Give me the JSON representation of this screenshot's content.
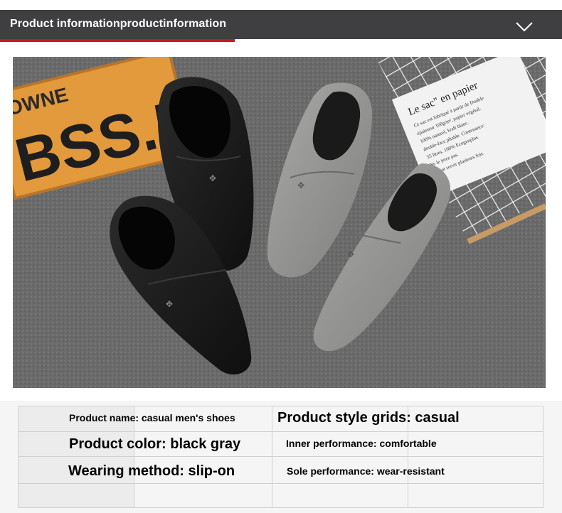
{
  "header": {
    "title": "Product information",
    "title_suffix": "productinformation",
    "accent_color": "#c8181e",
    "bar_color": "#3f3f41",
    "chevron_icon": "chevron-down-icon"
  },
  "photo": {
    "sign_text": "BSS.5C",
    "sign_subtext": "OWNE",
    "paper_bag_text": [
      "Le sac\" en papier",
      "Ce sac est fabriqué à partir de Double",
      "épaisseur 100g/m², papier végétal.",
      "100% naturel, kraft blanc.",
      "double-face pliable. Contenance:",
      "35 litres. 100% Ecogenplus.",
      "Ne le jetez pas.",
      "Il peut servir plusieurs fois."
    ]
  },
  "specs": {
    "product_name": "Product name: casual men's shoes",
    "product_style": "Product style grids: casual",
    "product_color": "Product color: black gray",
    "inner_performance": "Inner performance: comfortable",
    "wearing_method": "Wearing method: slip-on",
    "sole_performance": "Sole performance: wear-resistant"
  }
}
